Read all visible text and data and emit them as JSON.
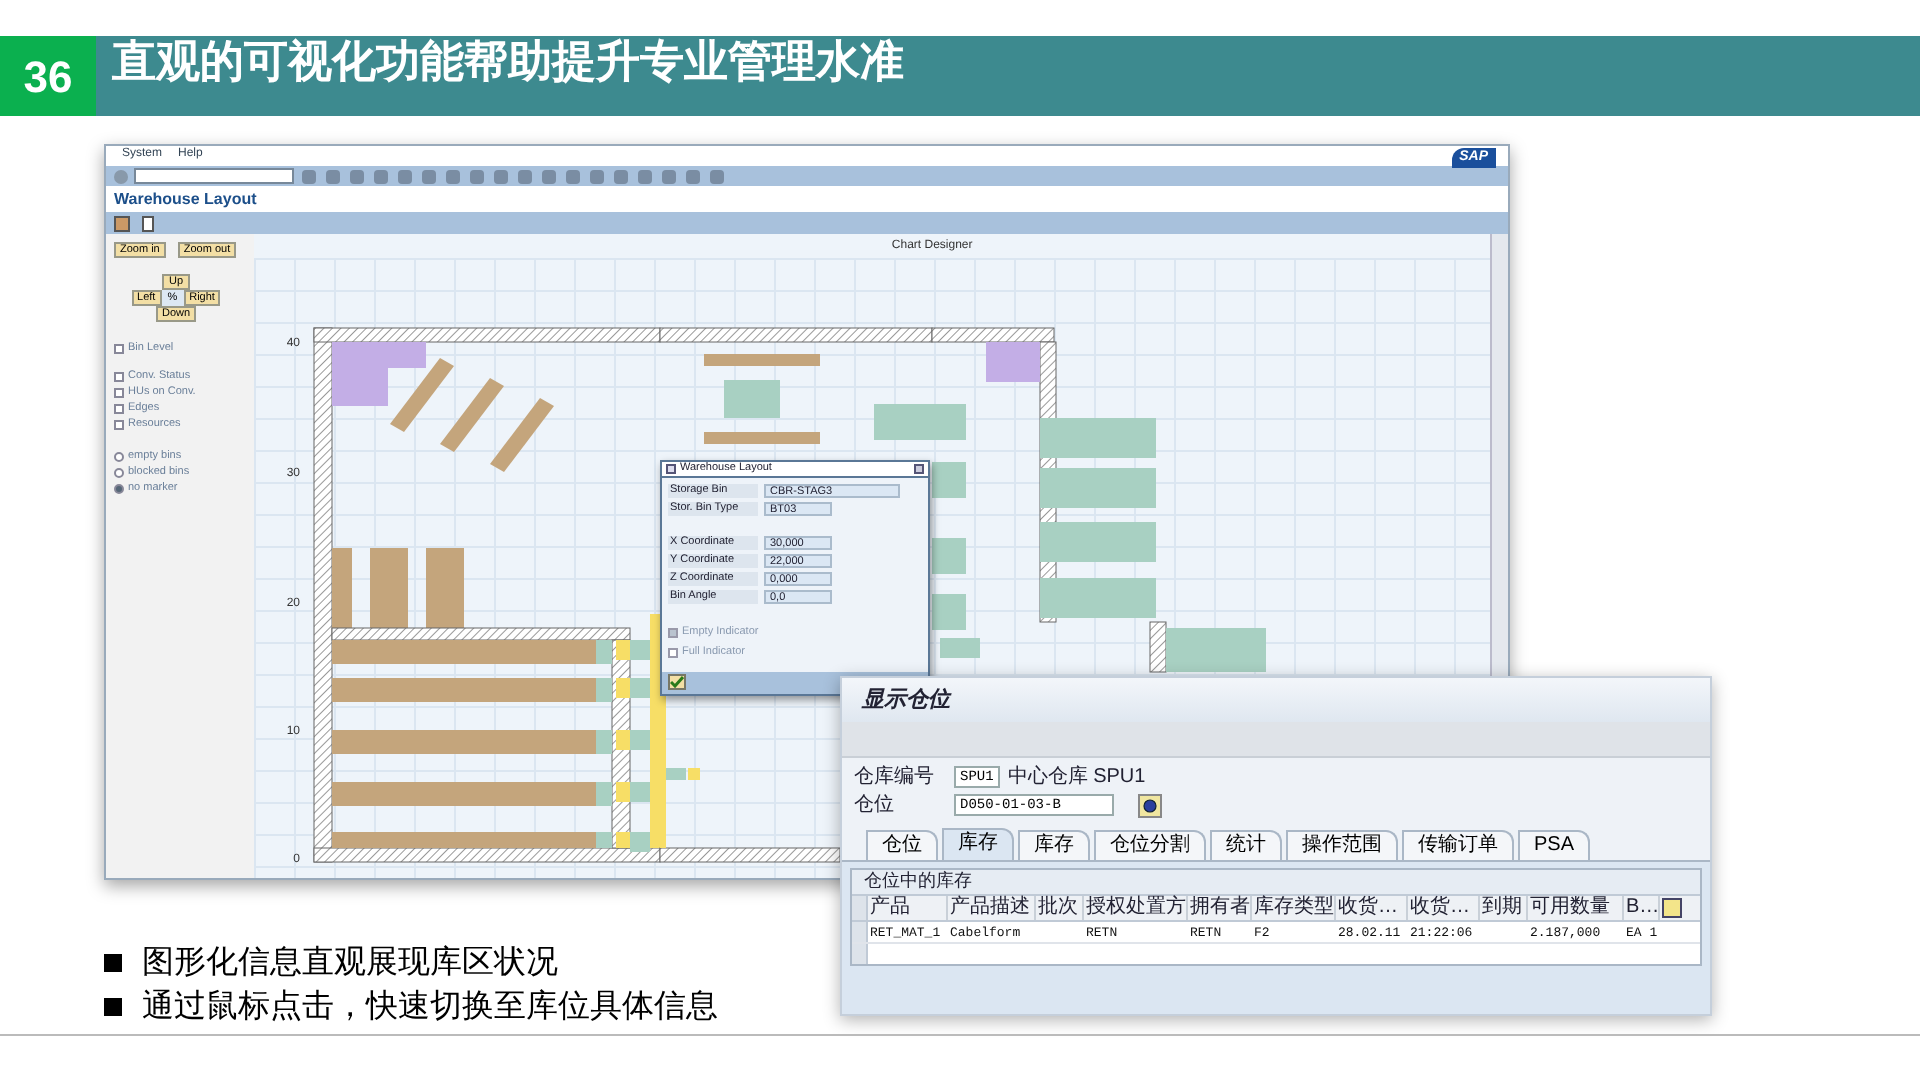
{
  "slide": {
    "number": "36",
    "title": "直观的可视化功能帮助提升专业管理水准"
  },
  "layout_window": {
    "menu": [
      {
        "label": "System"
      },
      {
        "label": "Help"
      }
    ],
    "logo": "SAP",
    "title": "Warehouse Layout",
    "zoom_buttons": [
      {
        "label": "Zoom in"
      },
      {
        "label": "Zoom out"
      }
    ],
    "nav": {
      "up": "Up",
      "left": "Left",
      "center": "%",
      "right": "Right",
      "down": "Down"
    },
    "options": [
      {
        "kind": "checkbox",
        "label": "Bin Level",
        "checked": false
      },
      {
        "kind": "checkbox",
        "label": "Conv. Status",
        "checked": false
      },
      {
        "kind": "checkbox",
        "label": "HUs on Conv.",
        "checked": false
      },
      {
        "kind": "checkbox",
        "label": "Edges",
        "checked": false
      },
      {
        "kind": "checkbox",
        "label": "Resources",
        "checked": false
      },
      {
        "kind": "radio",
        "label": "empty bins",
        "selected": false
      },
      {
        "kind": "radio",
        "label": "blocked bins",
        "selected": false
      },
      {
        "kind": "radio",
        "label": "no marker",
        "selected": true
      }
    ],
    "chart_title": "Chart Designer",
    "y_axis_labels": [
      "40",
      "30",
      "20",
      "10",
      "0"
    ],
    "dialog": {
      "title": "Warehouse Layout",
      "bin_fields": [
        {
          "label": "Storage Bin",
          "value": "CBR-STAG3"
        },
        {
          "label": "Stor. Bin Type",
          "value": "BT03"
        }
      ],
      "coordinate_fields": [
        {
          "label": "X Coordinate",
          "value": "30,000"
        },
        {
          "label": "Y Coordinate",
          "value": "22,000"
        },
        {
          "label": "Z Coordinate",
          "value": "0,000"
        },
        {
          "label": "Bin Angle",
          "value": "0,0"
        }
      ],
      "indicators": [
        {
          "label": "Empty Indicator",
          "checked": true
        },
        {
          "label": "Full Indicator",
          "checked": false
        }
      ]
    }
  },
  "bin_window": {
    "title": "显示仓位",
    "fields": [
      {
        "label": "仓库编号",
        "value": "SPU1",
        "note": "中心仓库 SPU1"
      },
      {
        "label": "仓位",
        "value": "D050-01-03-B"
      }
    ],
    "tabs": [
      {
        "label": "仓位",
        "selected": false
      },
      {
        "label": "库存",
        "selected": true
      },
      {
        "label": "库存",
        "selected": false
      },
      {
        "label": "仓位分割",
        "selected": false
      },
      {
        "label": "统计",
        "selected": false
      },
      {
        "label": "操作范围",
        "selected": false
      },
      {
        "label": "传输订单",
        "selected": false
      },
      {
        "label": "PSA",
        "selected": false
      }
    ],
    "table": {
      "title": "仓位中的库存",
      "columns": [
        "产品",
        "产品描述",
        "批次",
        "授权处置方",
        "拥有者",
        "库存类型",
        "收货…",
        "收货…",
        "到期",
        "可用数量",
        "B…"
      ],
      "rows": [
        [
          "RET_MAT_1",
          "Cabelform",
          "",
          "RETN",
          "RETN",
          "F2",
          "28.02.11",
          "21:22:06",
          "",
          "2.187,000",
          "EA 1"
        ]
      ]
    }
  },
  "bullets": [
    "图形化信息直观展现库区状况",
    "通过鼠标点击，快速切换至库位具体信息"
  ]
}
